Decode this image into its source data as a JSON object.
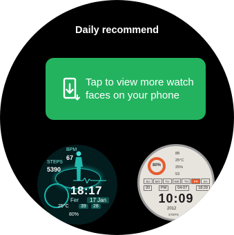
{
  "screen": {
    "title": "Daily recommend"
  },
  "tap_card": {
    "icon": "phone-download-icon",
    "text": "Tap to view more watch faces on your phone",
    "color": "#23b35f"
  },
  "face_digital": {
    "bpm_label": "BPM",
    "bpm_value": "67",
    "steps_label": "STEPS",
    "steps_value": "5390",
    "time": "18:17",
    "day": "Fer",
    "date": "17 Jan",
    "temperature": "25°C",
    "stat_a": "39",
    "stat_b": "28",
    "battery": "80%",
    "accent": "#16b8ad"
  },
  "face_analog": {
    "percent": "80%",
    "row1": "88",
    "row2": "25°C",
    "row3": "25%",
    "row4": "53",
    "days": [
      "SU",
      "MO",
      "TU",
      "WE",
      "TH",
      "FR",
      "SA"
    ],
    "active_day": "FR",
    "left_value": "20",
    "period": "PM",
    "date": "04-07",
    "right_value": "18:29",
    "time": "10:09",
    "year": "2012",
    "steps_label": "STEPS",
    "accent": "#e65c2e"
  }
}
